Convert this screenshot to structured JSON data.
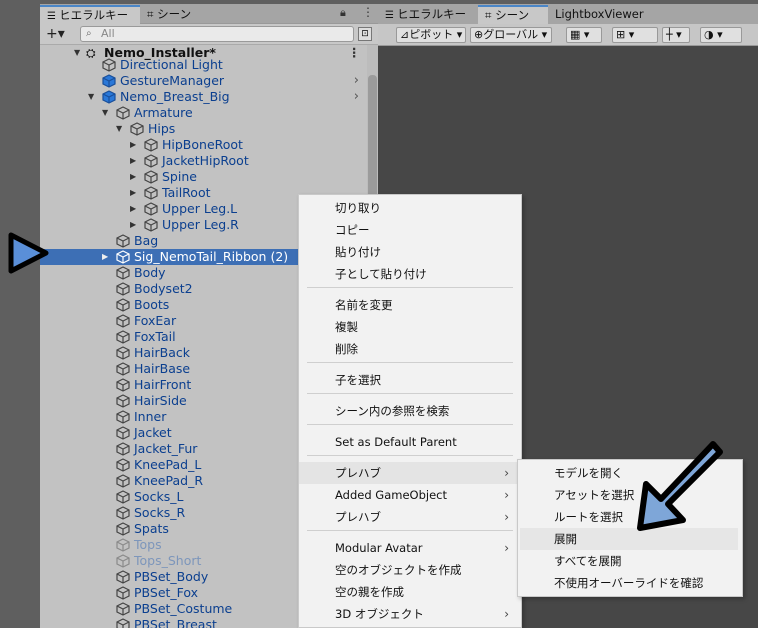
{
  "hierarchy": {
    "tabs": [
      "ヒエラルキー",
      "シーン"
    ],
    "search_placeholder": "All",
    "add_label": "+▾",
    "scene_title": "Nemo_Installer*",
    "rows": [
      {
        "label": "Directional Light",
        "style": "gray"
      },
      {
        "label": "GestureManager",
        "style": "gray"
      },
      {
        "label": "Nemo_Breast_Big",
        "style": "gray"
      },
      {
        "label": "Armature",
        "style": "gray"
      },
      {
        "label": "Hips",
        "style": "gray"
      },
      {
        "label": "HipBoneRoot",
        "style": "gray"
      },
      {
        "label": "JacketHipRoot",
        "style": "gray"
      },
      {
        "label": "Spine",
        "style": "gray"
      },
      {
        "label": "TailRoot",
        "style": "gray"
      },
      {
        "label": "Upper Leg.L",
        "style": "gray"
      },
      {
        "label": "Upper Leg.R",
        "style": "gray"
      },
      {
        "label": "Bag",
        "style": "gray"
      },
      {
        "label": "Sig_NemoTail_Ribbon (2)",
        "style": "sel"
      },
      {
        "label": "Body",
        "style": "gray"
      },
      {
        "label": "Bodyset2",
        "style": "gray"
      },
      {
        "label": "Boots",
        "style": "gray"
      },
      {
        "label": "FoxEar",
        "style": "gray"
      },
      {
        "label": "FoxTail",
        "style": "gray"
      },
      {
        "label": "HairBack",
        "style": "gray"
      },
      {
        "label": "HairBase",
        "style": "gray"
      },
      {
        "label": "HairFront",
        "style": "gray"
      },
      {
        "label": "HairSide",
        "style": "gray"
      },
      {
        "label": "Inner",
        "style": "gray"
      },
      {
        "label": "Jacket",
        "style": "gray"
      },
      {
        "label": "Jacket_Fur",
        "style": "gray"
      },
      {
        "label": "KneePad_L",
        "style": "gray"
      },
      {
        "label": "KneePad_R",
        "style": "gray"
      },
      {
        "label": "Socks_L",
        "style": "gray"
      },
      {
        "label": "Socks_R",
        "style": "gray"
      },
      {
        "label": "Spats",
        "style": "gray"
      },
      {
        "label": "Tops",
        "style": "faded"
      },
      {
        "label": "Tops_Short",
        "style": "faded"
      },
      {
        "label": "PBSet_Body",
        "style": "gray"
      },
      {
        "label": "PBSet_Fox",
        "style": "gray"
      },
      {
        "label": "PBSet_Costume",
        "style": "gray"
      },
      {
        "label": "PBSet_Breast",
        "style": "gray"
      }
    ]
  },
  "scene": {
    "tabs": [
      "ヒエラルキー",
      "シーン",
      "LightboxViewer"
    ],
    "toolbar": {
      "pivot": "ピボット",
      "global": "グローバル"
    }
  },
  "context_menu": {
    "items": [
      {
        "label": "切り取り"
      },
      {
        "label": "コピー"
      },
      {
        "label": "貼り付け"
      },
      {
        "label": "子として貼り付け"
      },
      {
        "label": "名前を変更"
      },
      {
        "label": "複製"
      },
      {
        "label": "削除"
      },
      {
        "label": "子を選択"
      },
      {
        "label": "シーン内の参照を検索"
      },
      {
        "label": "Set as Default Parent"
      },
      {
        "label": "プレハブ",
        "submenu": true
      },
      {
        "label": "Added GameObject",
        "submenu": true
      },
      {
        "label": "プレハブ",
        "submenu": true
      },
      {
        "label": "Modular Avatar",
        "submenu": true
      },
      {
        "label": "空のオブジェクトを作成"
      },
      {
        "label": "空の親を作成"
      },
      {
        "label": "3D オブジェクト",
        "submenu": true
      }
    ]
  },
  "submenu": {
    "items": [
      {
        "label": "モデルを開く"
      },
      {
        "label": "アセットを選択"
      },
      {
        "label": "ルートを選択"
      },
      {
        "label": "展開"
      },
      {
        "label": "すべてを展開"
      },
      {
        "label": "不使用オーバーライドを確認"
      }
    ]
  },
  "colors": {
    "selection": "#3d6fb5",
    "pointer_arrow": "#7ea6d8",
    "play_arrow": "#5a8fd8"
  }
}
